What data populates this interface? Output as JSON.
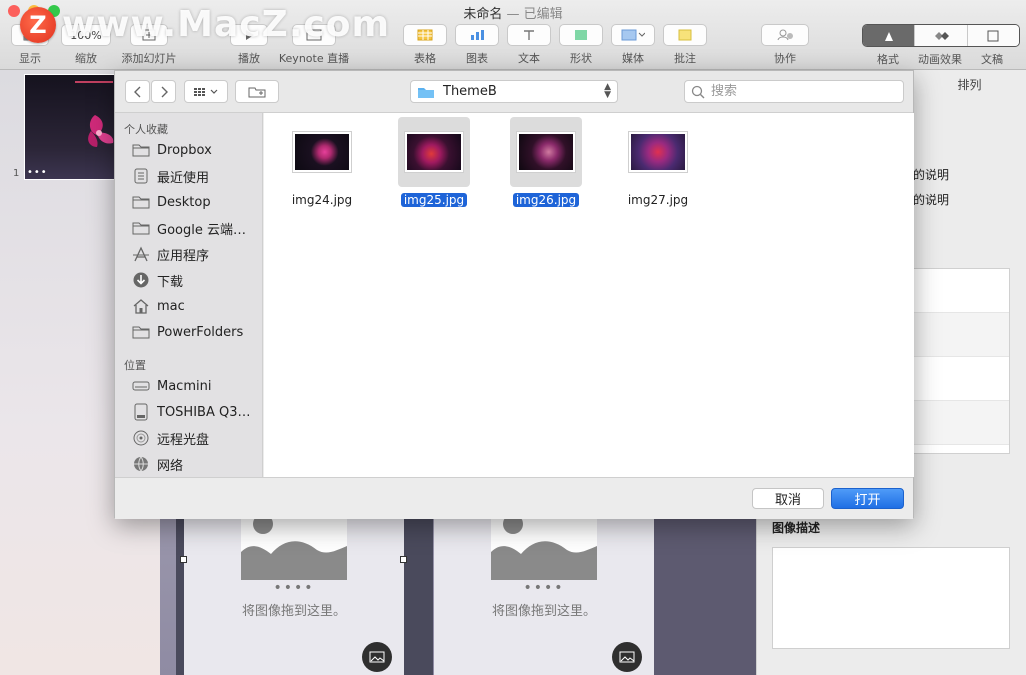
{
  "window": {
    "title": "未命名",
    "edited_suffix": "— 已编辑"
  },
  "watermark": {
    "logo_letter": "Z",
    "text": "www.MacZ.com"
  },
  "toolbar": {
    "items": [
      {
        "label": "显示",
        "icon": "view-icon"
      },
      {
        "label": "缩放",
        "icon": "zoom-icon",
        "value": "100%"
      },
      {
        "label": "添加幻灯片",
        "icon": "add-slide-icon"
      },
      {
        "label": "播放",
        "icon": "play-icon"
      },
      {
        "label": "Keynote 直播",
        "icon": "live-icon"
      },
      {
        "label": "表格",
        "icon": "table-icon"
      },
      {
        "label": "图表",
        "icon": "chart-icon"
      },
      {
        "label": "文本",
        "icon": "text-icon"
      },
      {
        "label": "形状",
        "icon": "shape-icon"
      },
      {
        "label": "媒体",
        "icon": "media-icon"
      },
      {
        "label": "批注",
        "icon": "comment-icon"
      },
      {
        "label": "协作",
        "icon": "collaborate-icon"
      }
    ],
    "inspector_tabs": [
      {
        "label": "格式",
        "icon": "format-icon",
        "active": true
      },
      {
        "label": "动画效果",
        "icon": "animate-icon",
        "active": false
      },
      {
        "label": "文稿",
        "icon": "document-icon",
        "active": false
      }
    ]
  },
  "navigator": {
    "slide_number": "1"
  },
  "canvas": {
    "placeholders": [
      {
        "dots": "••••",
        "hint": "将图像拖到这里。"
      },
      {
        "dots": "••••",
        "hint": "将图像拖到这里。"
      }
    ]
  },
  "inspector": {
    "tab": "排列",
    "lines": [
      "的说明",
      "的说明"
    ],
    "image_desc_label": "图像描述"
  },
  "dialog": {
    "location": "ThemeB",
    "search_placeholder": "搜索",
    "favorites_header": "个人收藏",
    "favorites": [
      {
        "label": "Dropbox",
        "icon": "folder-icon"
      },
      {
        "label": "最近使用",
        "icon": "recents-icon"
      },
      {
        "label": "Desktop",
        "icon": "folder-icon"
      },
      {
        "label": "Google 云端…",
        "icon": "folder-icon"
      },
      {
        "label": "应用程序",
        "icon": "applications-icon"
      },
      {
        "label": "下载",
        "icon": "download-icon"
      },
      {
        "label": "mac",
        "icon": "home-icon"
      },
      {
        "label": "PowerFolders",
        "icon": "folder-icon"
      }
    ],
    "locations_header": "位置",
    "locations": [
      {
        "label": "Macmini",
        "icon": "computer-icon"
      },
      {
        "label": "TOSHIBA Q3…",
        "icon": "drive-icon"
      },
      {
        "label": "远程光盘",
        "icon": "disc-icon"
      },
      {
        "label": "网络",
        "icon": "network-icon"
      }
    ],
    "files": [
      {
        "name": "img24.jpg",
        "selected": false
      },
      {
        "name": "img25.jpg",
        "selected": true
      },
      {
        "name": "img26.jpg",
        "selected": true
      },
      {
        "name": "img27.jpg",
        "selected": false
      }
    ],
    "cancel_label": "取消",
    "open_label": "打开"
  }
}
